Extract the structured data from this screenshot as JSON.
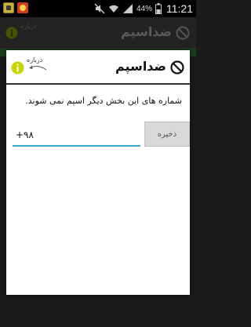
{
  "status_bar": {
    "battery_percent": "44%",
    "clock": "11:21"
  },
  "background_screen": {
    "title": "ضداسپم",
    "about_label": "درباره"
  },
  "dialog": {
    "title": "ضداسپم",
    "about_label": "درباره",
    "message": "شماره های این بخش دیگر اسپم نمی شوند.",
    "phone_input_value": "+۹۸",
    "save_label": "ذخیره"
  },
  "colors": {
    "input_underline": "#3aa9c8",
    "info_icon": "#c8d400",
    "background_bar": "#1a3d1a"
  },
  "icons": {
    "block": "block-icon",
    "info": "info-icon",
    "back_arrow": "curved-arrow-icon"
  }
}
